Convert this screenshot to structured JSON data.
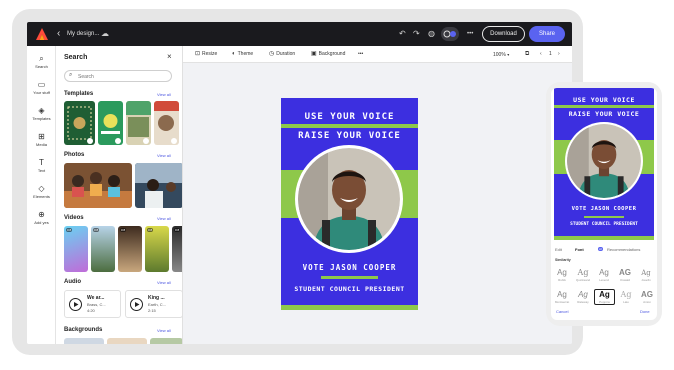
{
  "header": {
    "back_glyph": "‹",
    "title": "My design...",
    "cloud_glyph": "☁",
    "undo_glyph": "↶",
    "redo_glyph": "↷",
    "bulb_glyph": "◍",
    "more_glyph": "•••",
    "download_label": "Download",
    "share_label": "Share"
  },
  "rail": [
    {
      "icon": "⌕",
      "label": "Search",
      "name": "search-icon"
    },
    {
      "icon": "▭",
      "label": "Your stuff",
      "name": "folder-icon"
    },
    {
      "icon": "◈",
      "label": "Templates",
      "name": "templates-icon"
    },
    {
      "icon": "⊞",
      "label": "Media",
      "name": "media-icon"
    },
    {
      "icon": "T",
      "label": "Text",
      "name": "text-icon"
    },
    {
      "icon": "◇",
      "label": "Elements",
      "name": "elements-icon"
    },
    {
      "icon": "⊕",
      "label": "Add yes",
      "name": "add-icon"
    }
  ],
  "panel": {
    "title": "Search",
    "close_glyph": "×",
    "search_placeholder": "Search",
    "sections": {
      "templates": {
        "title": "Templates",
        "view_all": "View all"
      },
      "photos": {
        "title": "Photos",
        "view_all": "View all"
      },
      "videos": {
        "title": "Videos",
        "view_all": "View all"
      },
      "audio": {
        "title": "Audio",
        "view_all": "View all"
      },
      "backgrounds": {
        "title": "Backgrounds",
        "view_all": "View all"
      }
    },
    "audio_items": [
      {
        "title": "We ar...",
        "sub": "Brass, C...",
        "time": "4:20"
      },
      {
        "title": "King ...",
        "sub": "Earth, C...",
        "time": "2:15"
      }
    ],
    "video_badges": [
      "0:8",
      "0:8",
      "0:8",
      "0:8",
      "0:8"
    ],
    "template_texts": [
      "MIDDLE YOUTH CONFERENCE",
      "EARTH YOUTH DAY"
    ]
  },
  "toolbar": {
    "resize": "Resize",
    "theme": "Theme",
    "duration": "Duration",
    "background": "Background",
    "more": "•••",
    "zoom": "100%",
    "page_num": "1"
  },
  "poster": {
    "line1": "USE YOUR VOICE",
    "line2": "RAISE YOUR VOICE",
    "line3": "VOTE JASON COOPER",
    "line4": "STUDENT COUNCIL PRESIDENT",
    "bg_color": "#3c2fe0",
    "accent_color": "#8ec84a"
  },
  "phone": {
    "tabs": [
      "Edit",
      "Font"
    ],
    "badge": "AI",
    "recommendations": "Recommendations",
    "similarity": "Similarity",
    "fonts_row1": [
      "Ag",
      "Ag",
      "Ag",
      "AG",
      "Ag"
    ],
    "fonts_row1_names": [
      "Rubik",
      "Quicksand",
      "Lexend",
      "Oswald",
      "Josefin"
    ],
    "fonts_row2": [
      "Ag",
      "Ag",
      "Ag",
      "Ag",
      "AG"
    ],
    "fonts_row2_names": [
      "Montserrat",
      "Raleway",
      "Poppins",
      "Lato",
      "Anton"
    ],
    "cancel": "Cancel",
    "done": "Done"
  }
}
